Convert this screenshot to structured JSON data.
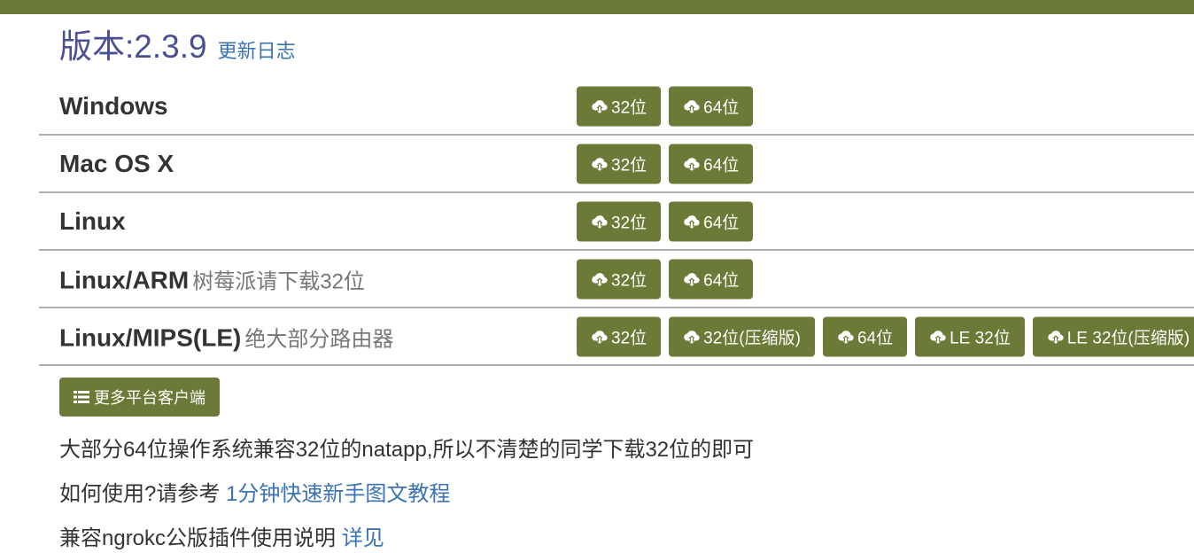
{
  "header": {
    "version_label": "版本: ",
    "version_value": "2.3.9",
    "changelog_link": "更新日志"
  },
  "platforms": [
    {
      "name": "Windows",
      "note": "",
      "buttons": [
        "32位",
        "64位"
      ]
    },
    {
      "name": "Mac OS X",
      "note": "",
      "buttons": [
        "32位",
        "64位"
      ]
    },
    {
      "name": "Linux",
      "note": "",
      "buttons": [
        "32位",
        "64位"
      ]
    },
    {
      "name": "Linux/ARM",
      "note": "树莓派请下载32位",
      "buttons": [
        "32位",
        "64位"
      ]
    },
    {
      "name": "Linux/MIPS(LE)",
      "note": "绝大部分路由器",
      "buttons": [
        "32位",
        "32位(压缩版)",
        "64位",
        "LE 32位",
        "LE 32位(压缩版)"
      ]
    }
  ],
  "more_clients_button": "更多平台客户端",
  "notes": {
    "compat_text": "大部分64位操作系统兼容32位的natapp,所以不清楚的同学下载32位的即可",
    "howto_prefix": "如何使用?请参考 ",
    "howto_link": "1分钟快速新手图文教程",
    "ngrok_prefix": "兼容ngrokc公版插件使用说明 ",
    "ngrok_link": "详见"
  },
  "colors": {
    "brand_green": "#6b7a36",
    "version_purple": "#4a5092",
    "link_blue": "#3b73b6"
  },
  "icons": {
    "download": "cloud-download-icon",
    "list": "list-icon"
  }
}
